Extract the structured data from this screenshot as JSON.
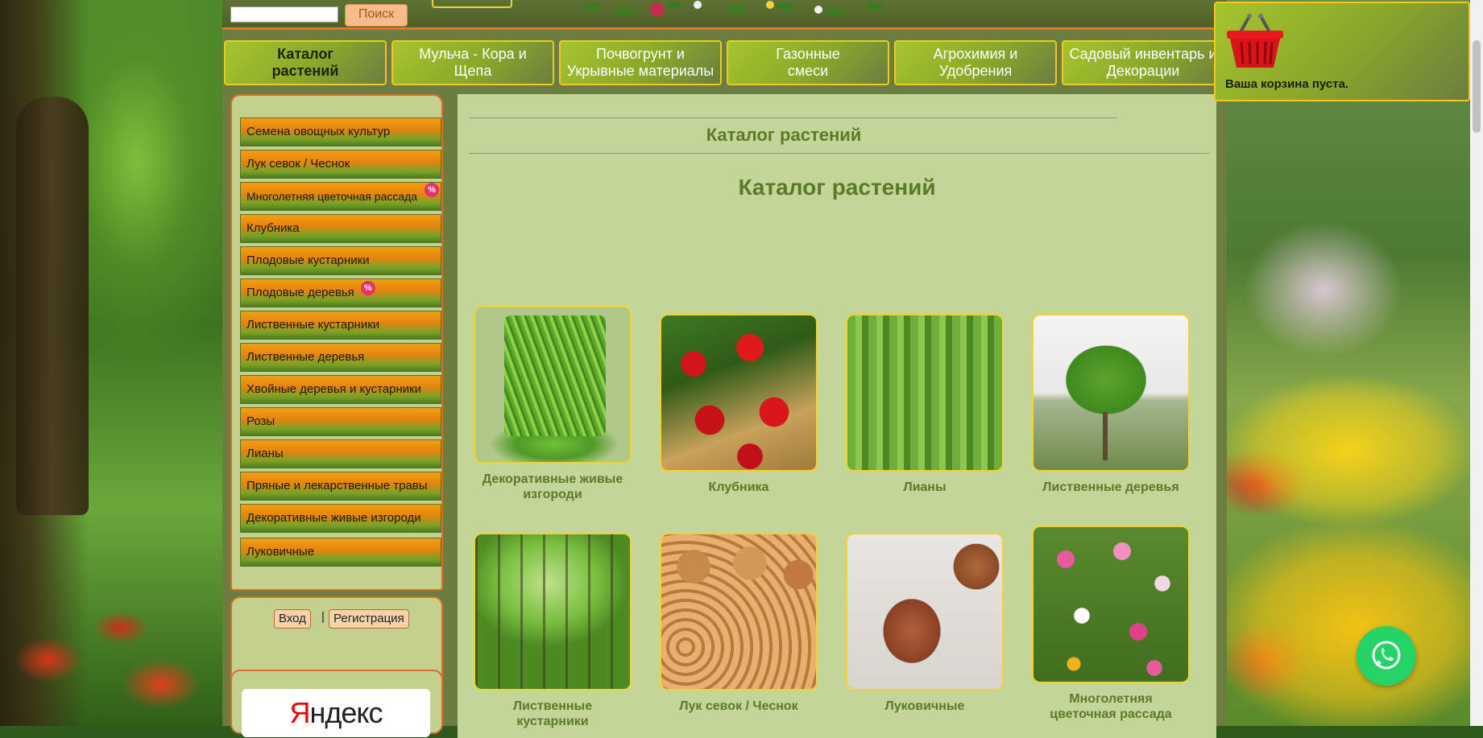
{
  "search": {
    "placeholder": "",
    "button_label": "Поиск"
  },
  "nav": {
    "items": [
      {
        "label": "Каталог\nрастений",
        "active": true
      },
      {
        "label": "Мульча - Кора и\nЩепа",
        "active": false
      },
      {
        "label": "Почвогрунт и\nУкрывные материалы",
        "active": false
      },
      {
        "label": "Газонные\nсмеси",
        "active": false
      },
      {
        "label": "Агрохимия и\nУдобрения",
        "active": false
      },
      {
        "label": "Садовый инвентарь и\nДекорации",
        "active": false
      }
    ]
  },
  "sidebar": {
    "items": [
      {
        "label": "Семена овощных культур"
      },
      {
        "label": "Лук севок / Чеснок"
      },
      {
        "label": "Многолетняя цветочная рассада",
        "badge": "%"
      },
      {
        "label": "Клубника"
      },
      {
        "label": "Плодовые кустарники"
      },
      {
        "label": "Плодовые деревья",
        "badge": "%"
      },
      {
        "label": "Лиственные кустарники"
      },
      {
        "label": "Лиственные деревья"
      },
      {
        "label": "Хвойные деревья и кустарники"
      },
      {
        "label": "Розы"
      },
      {
        "label": "Лианы"
      },
      {
        "label": "Пряные и лекарственные травы"
      },
      {
        "label": "Декоративные живые изгороди"
      },
      {
        "label": "Луковичные"
      }
    ]
  },
  "auth": {
    "login_label": "Вход",
    "separator": "|",
    "register_label": "Регистрация"
  },
  "yandex": {
    "logo_text_first": "Я",
    "logo_text_rest": "ндекс"
  },
  "content": {
    "heading_small": "Каталог растений",
    "heading_large": "Каталог растений",
    "cards": [
      {
        "name": "Декоративные живые изгороди",
        "image": "hedge"
      },
      {
        "name": "Клубника",
        "image": "strawberry"
      },
      {
        "name": "Лианы",
        "image": "liana"
      },
      {
        "name": "Лиственные деревья",
        "image": "tree"
      },
      {
        "name": "Лиственные кустарники",
        "image": "forest"
      },
      {
        "name": "Лук севок / Чеснок",
        "image": "onion"
      },
      {
        "name": "Луковичные",
        "image": "bulb"
      },
      {
        "name": "Многолетняя цветочная рассада",
        "image": "flowers"
      }
    ]
  },
  "cart": {
    "status_text": "Ваша корзина пуста.",
    "icon": "basket-icon"
  },
  "whatsapp": {
    "icon": "whatsapp-icon",
    "color": "#25d366"
  },
  "colors": {
    "accent_orange": "#e6781c",
    "nav_border": "#f0c81e",
    "heading_green": "#5a7a2a"
  }
}
